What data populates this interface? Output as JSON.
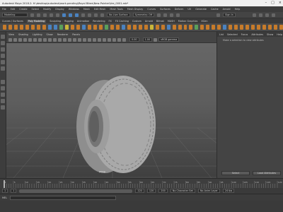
{
  "window": {
    "title": "Autodesk Maya 2018.2: H:\\desktop\\autodesk\\work-pending\\Royal Bikes\\New-Pointer\\tire_0001.mb*",
    "controls": [
      "–",
      "□",
      "×"
    ]
  },
  "menubar": {
    "items": [
      "File",
      "Edit",
      "Create",
      "Select",
      "Modify",
      "Display",
      "Windows",
      "Mesh",
      "Edit Mesh",
      "Mesh Tools",
      "Mesh Display",
      "Curves",
      "Surfaces",
      "Deform",
      "UV",
      "Generate",
      "Cache",
      "Arnold",
      "Help"
    ]
  },
  "statusline": {
    "workspace": "Modeling",
    "no_live_surface": "No Live Surface",
    "symmetry": "Symmetry: Off",
    "sign_in": "Sign In"
  },
  "shelf": {
    "tabs": [
      "Curves / Surfaces",
      "Poly Modeling",
      "Sculpting",
      "Rigging",
      "Animation",
      "Rendering",
      "FX",
      "FX Caching",
      "Custom",
      "Arnold",
      "Bifrost",
      "MASH",
      "Motion Graphics",
      "XGen"
    ],
    "active_tab": "Poly Modeling",
    "icon_colors": [
      "#c77b2a",
      "#c77b2a",
      "#c77b2a",
      "#c77b2a",
      "#c77b2a",
      "#c77b2a",
      "#c77b2a",
      "#c77b2a",
      "#4a82c0",
      "#4a82c0",
      "#5aa05a",
      "#c9b63a",
      "#c77b2a",
      "#c77b2a",
      "#4a82c0",
      "#c77b2a",
      "#c77b2a",
      "#c77b2a",
      "#5aa05a",
      "#c77b2a",
      "#c77b2a",
      "#4a82c0",
      "#c77b2a",
      "#c77b2a",
      "#c77b2a",
      "#c77b2a",
      "#c9b63a",
      "#c77b2a",
      "#c77b2a",
      "#4a82c0",
      "#c77b2a",
      "#c77b2a",
      "#c77b2a",
      "#c77b2a",
      "#5aa05a",
      "#c77b2a",
      "#c77b2a",
      "#c77b2a",
      "#c77b2a",
      "#4a82c0",
      "#c77b2a",
      "#c77b2a",
      "#c77b2a",
      "#c77b2a",
      "#c77b2a",
      "#c77b2a",
      "#c77b2a",
      "#c77b2a",
      "#c77b2a",
      "#c77b2a"
    ]
  },
  "viewport": {
    "menu": [
      "View",
      "Shading",
      "Lighting",
      "Show",
      "Renderer",
      "Panels"
    ],
    "near_clip": "0.00",
    "far_clip": "1.00",
    "color_space": "sRGB gamma",
    "camera": "persp"
  },
  "attribute_editor": {
    "tabs": [
      "List",
      "Selected",
      "Focus",
      "Attributes",
      "Show",
      "Help"
    ],
    "message": "Make a selection to view attributes",
    "buttons": [
      "Select",
      "Load Attributes"
    ]
  },
  "timeline": {
    "ticks": [
      "1",
      "5",
      "10",
      "15",
      "20",
      "25",
      "30",
      "35",
      "40",
      "45",
      "50",
      "55",
      "60",
      "65",
      "70",
      "75",
      "80",
      "85",
      "90",
      "95",
      "100",
      "105",
      "110",
      "115",
      "120"
    ],
    "current_frame": "1"
  },
  "range": {
    "start": "1",
    "inner_start": "1",
    "inner_end": "120",
    "end": "120",
    "end_alt": "200",
    "character_set": "No Character Set",
    "anim_layer": "No Anim Layer",
    "fps": "24 fps"
  },
  "cmdline": {
    "mode": "MEL"
  }
}
